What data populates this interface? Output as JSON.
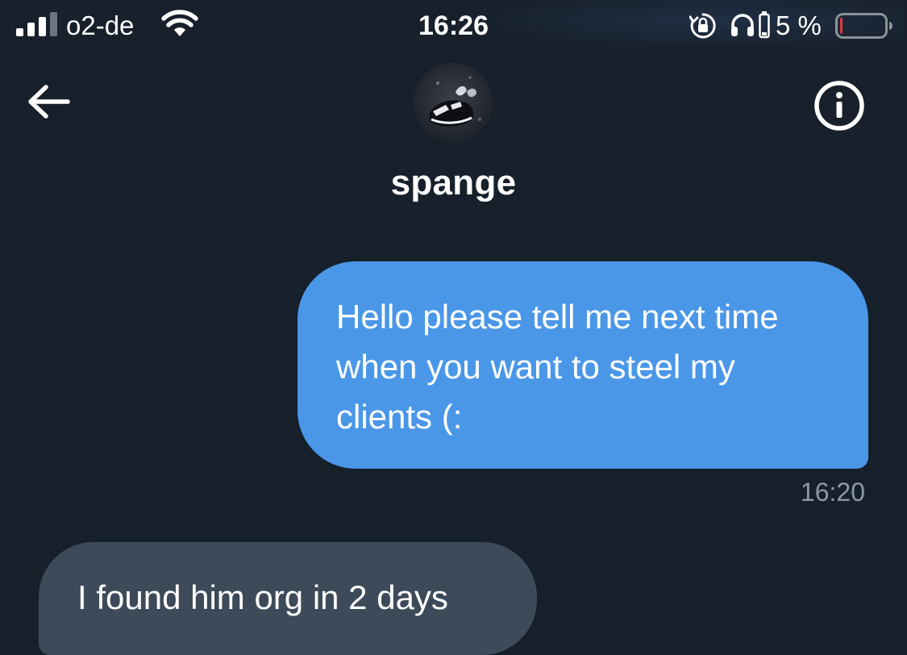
{
  "status_bar": {
    "carrier": "o2-de",
    "time": "16:26",
    "battery_percent": "5 %",
    "battery_level": 0.05,
    "signal_icon": "cellular-signal-icon",
    "wifi_icon": "wifi-icon",
    "rotation_lock_icon": "rotation-lock-icon",
    "headphones_icon": "headphones-icon",
    "battery_icon": "battery-icon"
  },
  "header": {
    "username": "spange",
    "back_icon": "back-arrow-icon",
    "info_icon": "info-icon"
  },
  "messages": [
    {
      "direction": "sent",
      "text": "Hello please tell me next time when you want to steel my clients (:",
      "time": "16:20"
    },
    {
      "direction": "received",
      "text": "I found him org in 2 days"
    }
  ],
  "colors": {
    "background": "#15202b",
    "sent_bubble": "#4a97e8",
    "received_bubble": "#3d4a59",
    "timestamp": "#8b98a5",
    "battery_low": "#e0383e"
  }
}
